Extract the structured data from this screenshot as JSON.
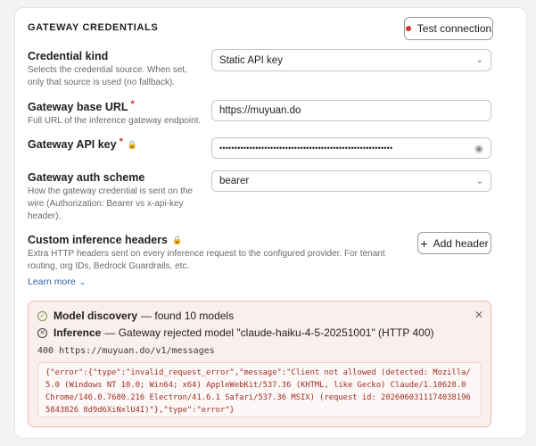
{
  "section": {
    "title": "GATEWAY CREDENTIALS",
    "test_button": "Test connection"
  },
  "credential_kind": {
    "label": "Credential kind",
    "description": "Selects the credential source. When set, only that source is used (no fallback).",
    "value": "Static API key"
  },
  "base_url": {
    "label": "Gateway base URL",
    "required_mark": "*",
    "description": "Full URL of the inference gateway endpoint.",
    "value": "https://muyuan.do"
  },
  "api_key": {
    "label": "Gateway API key",
    "required_mark": "*",
    "value": "••••••••••••••••••••••••••••••••••••••••••••••••••••••••••"
  },
  "auth_scheme": {
    "label": "Gateway auth scheme",
    "description": "How the gateway credential is sent on the wire (Authorization: Bearer vs x-api-key header).",
    "value": "bearer"
  },
  "custom_headers": {
    "label": "Custom inference headers",
    "description": "Extra HTTP headers sent on every inference request to the configured provider. For tenant routing, org IDs, Bedrock Guardrails, etc.",
    "add_button": "Add header"
  },
  "learn_more": "Learn more",
  "results": {
    "discovery_title": "Model discovery",
    "discovery_text": "— found 10 models",
    "inference_title": "Inference",
    "inference_text": "— Gateway rejected model \"claude-haiku-4-5-20251001\" (HTTP 400)",
    "endpoint": "400 https://muyuan.do/v1/messages",
    "response_body": "{\"error\":{\"type\":\"invalid_request_error\",\"message\":\"Client not allowed (detected: Mozilla/5.0 (Windows NT 10.0; Win64; x64) AppleWebKit/537.36 (KHTML, like Gecko) Claude/1.10628.0 Chrome/146.0.7680.216 Electron/41.6.1 Safari/537.36 MSIX) (request id: 20260603111740381965843826 8d9d6XiNxlU4I)\"},\"type\":\"error\"}"
  },
  "colors": {
    "accent_red": "#c93a32",
    "success_green": "#7a8f3c",
    "link_blue": "#2f5fa8"
  }
}
